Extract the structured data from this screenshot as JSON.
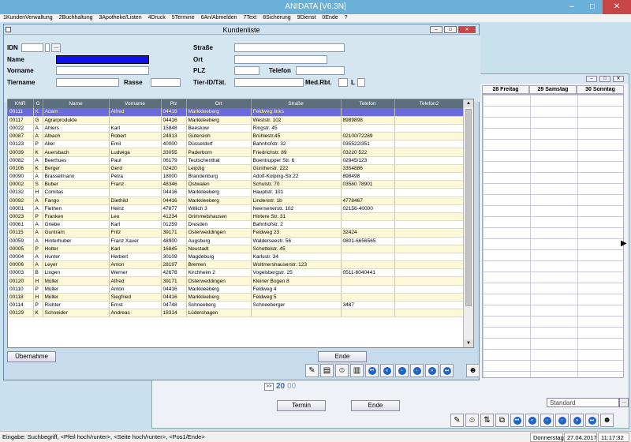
{
  "app": {
    "title": "ANIDATA [V6.3N]"
  },
  "window_controls": {
    "minimize": "–",
    "maximize": "□",
    "close": "✕"
  },
  "menu": [
    "1KundenVerwaltung",
    "2Buchhaltung",
    "3Apotheke/Listen",
    "4Druck",
    "5Termine",
    "6An/Abmelden",
    "7Text",
    "8Sicherung",
    "9Dienst",
    "0Ende",
    "?"
  ],
  "calendar": {
    "days": [
      "28 Freitag",
      "29 Samstag",
      "30 Sonntag"
    ],
    "nav_prev": ">>",
    "nav_num": "20",
    "nav_num2": "00",
    "standard_value": "Standard",
    "standard_button": "...",
    "termin_button": "Termin",
    "ende_button": "Ende"
  },
  "dialog": {
    "title": "Kundenliste",
    "labels": {
      "idn": "IDN",
      "name": "Name",
      "vorname": "Vorname",
      "tiername": "Tiername",
      "rasse": "Rasse",
      "strasse": "Straße",
      "ort": "Ort",
      "plz": "PLZ",
      "telefon": "Telefon",
      "tier_id": "Tier-ID/Tät.",
      "med_rbt": "Med.Rbt.",
      "l": "L"
    },
    "browse_button": "...",
    "columns": [
      "KNR",
      "G",
      "Name",
      "Vorname",
      "Plz",
      "Ort",
      "Straße",
      "Telefon",
      "Telefon2"
    ],
    "rows": [
      [
        "00111",
        "K",
        "Adam",
        "Alfred",
        "04416",
        "Markkleeberg",
        "Feldweg links",
        "",
        ""
      ],
      [
        "00117",
        "G",
        "Agrarprodukte",
        "",
        "04416",
        "Markkleeberg",
        "Weststr. 102",
        "8989898",
        ""
      ],
      [
        "00022",
        "A",
        "Ahlers",
        "Karl",
        "15848",
        "Beeskow",
        "Ringstr. 45",
        "",
        ""
      ],
      [
        "00087",
        "A",
        "Albach",
        "Robert",
        "24913",
        "Gütersloh",
        "Brühlestr.45",
        "02100/72289",
        ""
      ],
      [
        "00123",
        "P",
        "Aller",
        "Emil",
        "40000",
        "Düsseldorf",
        "Bahnhofstr. 32",
        "035522/351",
        ""
      ],
      [
        "00039",
        "K",
        "Auersbach",
        "Ludwiga",
        "33055",
        "Paderborn",
        "Friedrichstr. 89",
        "03220 522",
        ""
      ],
      [
        "00082",
        "A",
        "Beerhues",
        "Paul",
        "06179",
        "Teutschenthal",
        "Boentrupper Str. 6",
        "02945/123",
        ""
      ],
      [
        "00106",
        "K",
        "Berger",
        "Gerd",
        "02420",
        "Leipzig",
        "Güntherstr. 222",
        "3354886",
        ""
      ],
      [
        "00090",
        "A",
        "Brasselmann",
        "Petra",
        "18000",
        "Brandenburg",
        "Adolf-Kolping-Str.22",
        "898498",
        ""
      ],
      [
        "00002",
        "S",
        "Buber",
        "Franz",
        "48346",
        "Ostwalen",
        "Schulstr. 70",
        "03560 78901",
        ""
      ],
      [
        "00132",
        "H",
        "Comitas",
        "",
        "04416",
        "Markkleeberg",
        "Hauptstr. 101",
        "",
        ""
      ],
      [
        "00092",
        "A",
        "Fango",
        "Diethild",
        "04416",
        "Markkleeberg",
        "Lindenstr. 1b",
        "4778467",
        ""
      ],
      [
        "00001",
        "A",
        "Fiethen",
        "Heinz",
        "47877",
        "Willich 3",
        "Neersenerstr. 102",
        "02156-40000",
        ""
      ],
      [
        "00023",
        "P",
        "Franken",
        "Leo",
        "41234",
        "Grimmelshausen",
        "Hintere Str. 31",
        "",
        ""
      ],
      [
        "00061",
        "A",
        "Griebe",
        "Karl",
        "01259",
        "Dresden",
        "Bahnhofstr. 2",
        "",
        ""
      ],
      [
        "00115",
        "A",
        "Guntram",
        "Fritz",
        "39171",
        "Osterweddingen",
        "Feldweg 23",
        "32424",
        ""
      ],
      [
        "00059",
        "A",
        "Hinterhuber",
        "Franz Xaver",
        "48900",
        "Augsburg",
        "Walderseestr. 56",
        "0801-6656565",
        ""
      ],
      [
        "00005",
        "P",
        "Holter",
        "Karl",
        "16845",
        "Neustadt",
        "Schottelstr. 45",
        "",
        ""
      ],
      [
        "00004",
        "A",
        "Hunter",
        "Herbert",
        "30109",
        "Magdeburg",
        "Karlsstr. 34",
        "",
        ""
      ],
      [
        "00006",
        "A",
        "Leyer",
        "Anton",
        "28197",
        "Bremen",
        "Woltmershauserstr. 123",
        "",
        ""
      ],
      [
        "00003",
        "B",
        "Lingen",
        "Werner",
        "42678",
        "Kirchheim 2",
        "Vogelsbergstr. 25",
        "0511-6040441",
        ""
      ],
      [
        "00120",
        "H",
        "Müller",
        "Alfred",
        "39171",
        "Osterweddingen",
        "Kleiner Bogen 8",
        "",
        ""
      ],
      [
        "00110",
        "P",
        "Müller",
        "Anton",
        "04416",
        "Markkleeberg",
        "Feldweg 4",
        "",
        ""
      ],
      [
        "00118",
        "H",
        "Müller",
        "Siegfried",
        "04416",
        "Markkleeberg",
        "Feldweg 5",
        "",
        ""
      ],
      [
        "00114",
        "P",
        "Richter",
        "Ernst",
        "04748",
        "Schneeberg",
        "Schneeberger",
        "3487",
        ""
      ],
      [
        "00129",
        "K",
        "Schneider",
        "Andreas",
        "18314",
        "Lüdershagen",
        "",
        "",
        ""
      ]
    ],
    "uebernahme_button": "Übernahme",
    "ende_button": "Ende"
  },
  "statusbar": {
    "hint": "Eingabe: Suchbegriff, <Pfeil hoch/runter>, <Seite hoch/runter>, <Pos1/Ende>",
    "day": "Donnerstag",
    "date": "27.04.2017",
    "time": "11:17:32"
  }
}
